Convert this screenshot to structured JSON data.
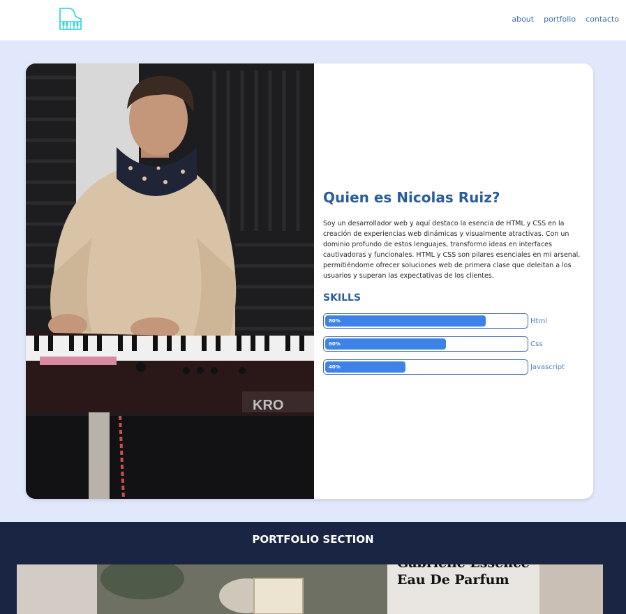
{
  "header": {
    "logo_icon": "piano-icon",
    "nav": [
      {
        "label": "about"
      },
      {
        "label": "portfolio"
      },
      {
        "label": "contacto"
      }
    ]
  },
  "about": {
    "photo_icon": "pianist-photo",
    "title": "Quien es Nicolas Ruiz?",
    "text": "Soy un desarrollador web y aquí destaco la esencia de HTML y CSS en la creación de experiencias web dinámicas y visualmente atractivas. Con un dominio profundo de estos lenguajes, transformo ideas en interfaces cautivadoras y funcionales. HTML y CSS son pilares esenciales en mi arsenal, permitiéndome ofrecer soluciones web de primera clase que deleitan a los usuarios y superan las expectativas de los clientes.",
    "skills_title": "SKILLS",
    "skills": [
      {
        "name": "Html",
        "percent_label": "80%",
        "value": 80
      },
      {
        "name": "Css",
        "percent_label": "60%",
        "value": 60
      },
      {
        "name": "Javascript",
        "percent_label": "40%",
        "value": 40
      }
    ]
  },
  "portfolio": {
    "title": "PORTFOLIO SECTION",
    "image_text": [
      "Gabrielle Essence",
      "Eau De Parfum"
    ]
  },
  "colors": {
    "accent": "#2a5e9b",
    "bar": "#3d82e6",
    "page_bg": "#e2e8fb",
    "portfolio_bg": "#1a2543"
  }
}
